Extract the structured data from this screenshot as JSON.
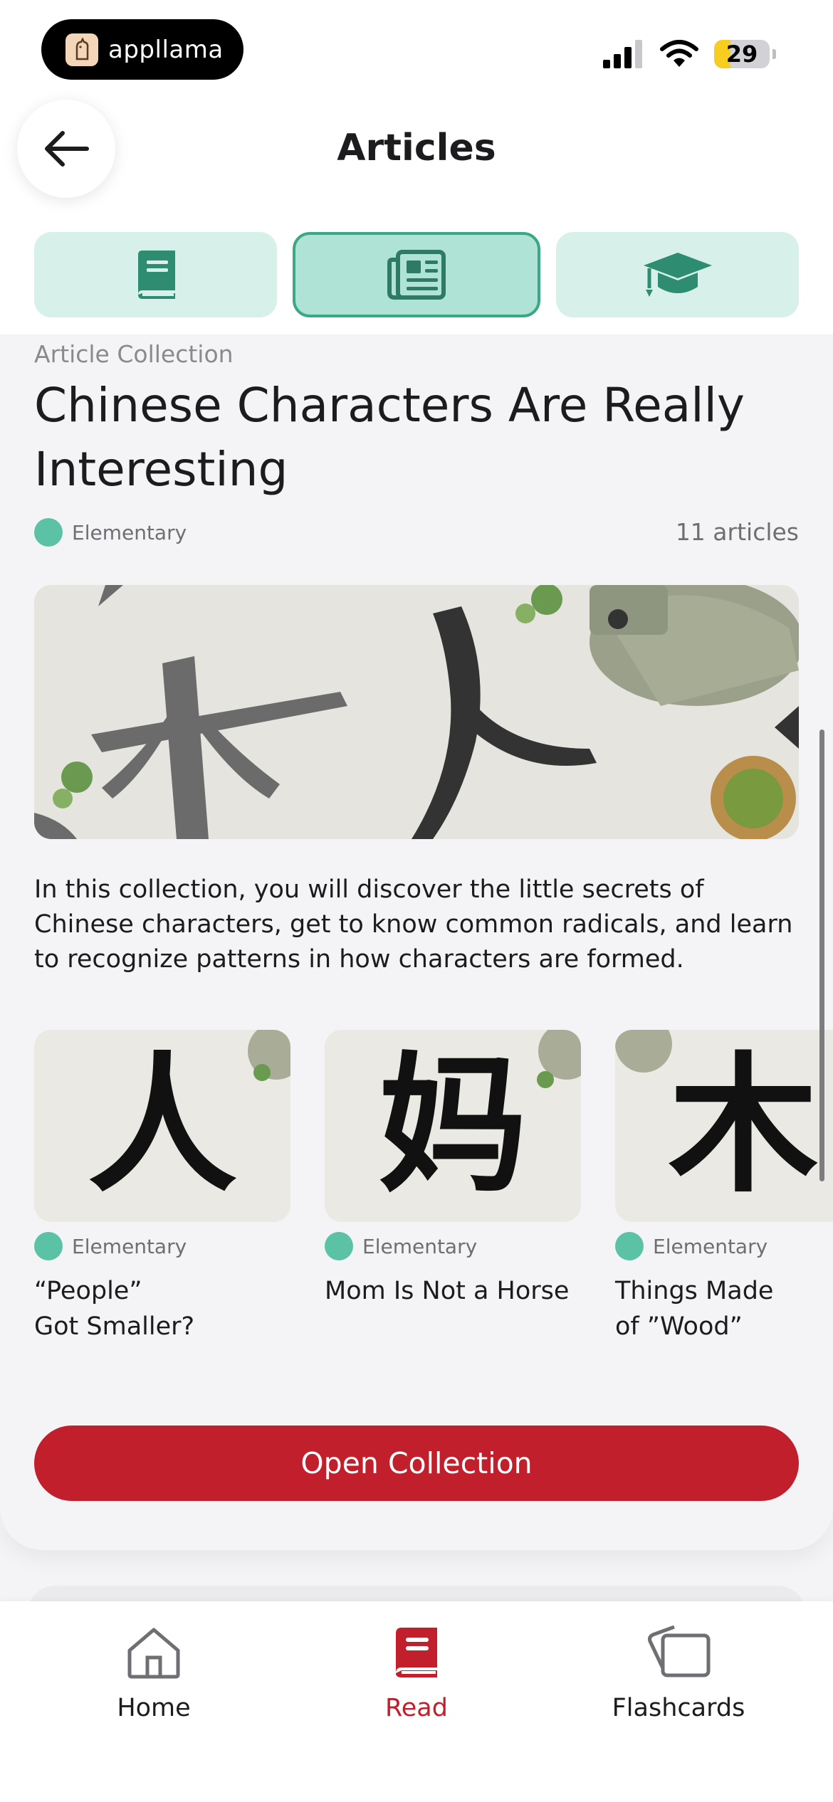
{
  "status_bar": {
    "app_name": "appllama",
    "battery": "29",
    "battery_level_percent": 29
  },
  "header": {
    "title": "Articles",
    "back_icon": "arrow-left-icon"
  },
  "tabs": [
    {
      "icon": "book-icon",
      "active": false
    },
    {
      "icon": "newspaper-icon",
      "active": true
    },
    {
      "icon": "graduation-cap-icon",
      "active": false
    }
  ],
  "collection": {
    "label": "Article Collection",
    "title": "Chinese Characters Are Really Interesting",
    "level": "Elementary",
    "article_count": "11 articles",
    "description": "In this collection, you will discover the little secrets of Chinese characters, get to know common radicals, and learn to recognize patterns in how characters are formed.",
    "articles": [
      {
        "level": "Elementary",
        "title": "“People”\nGot Smaller?",
        "character": "人"
      },
      {
        "level": "Elementary",
        "title": "Mom Is Not a Horse",
        "character": "妈"
      },
      {
        "level": "Elementary",
        "title": "Things Made\nof ”Wood”",
        "character": "木"
      }
    ],
    "open_button": "Open Collection"
  },
  "bottom_nav": [
    {
      "label": "Home",
      "icon": "home-icon",
      "active": false
    },
    {
      "label": "Read",
      "icon": "book-icon",
      "active": true
    },
    {
      "label": "Flashcards",
      "icon": "flashcards-icon",
      "active": false
    }
  ],
  "colors": {
    "accent_red": "#c01f2b",
    "teal": "#3aa887",
    "teal_light": "#d7f1ea",
    "level_dot": "#5bc2a5"
  }
}
